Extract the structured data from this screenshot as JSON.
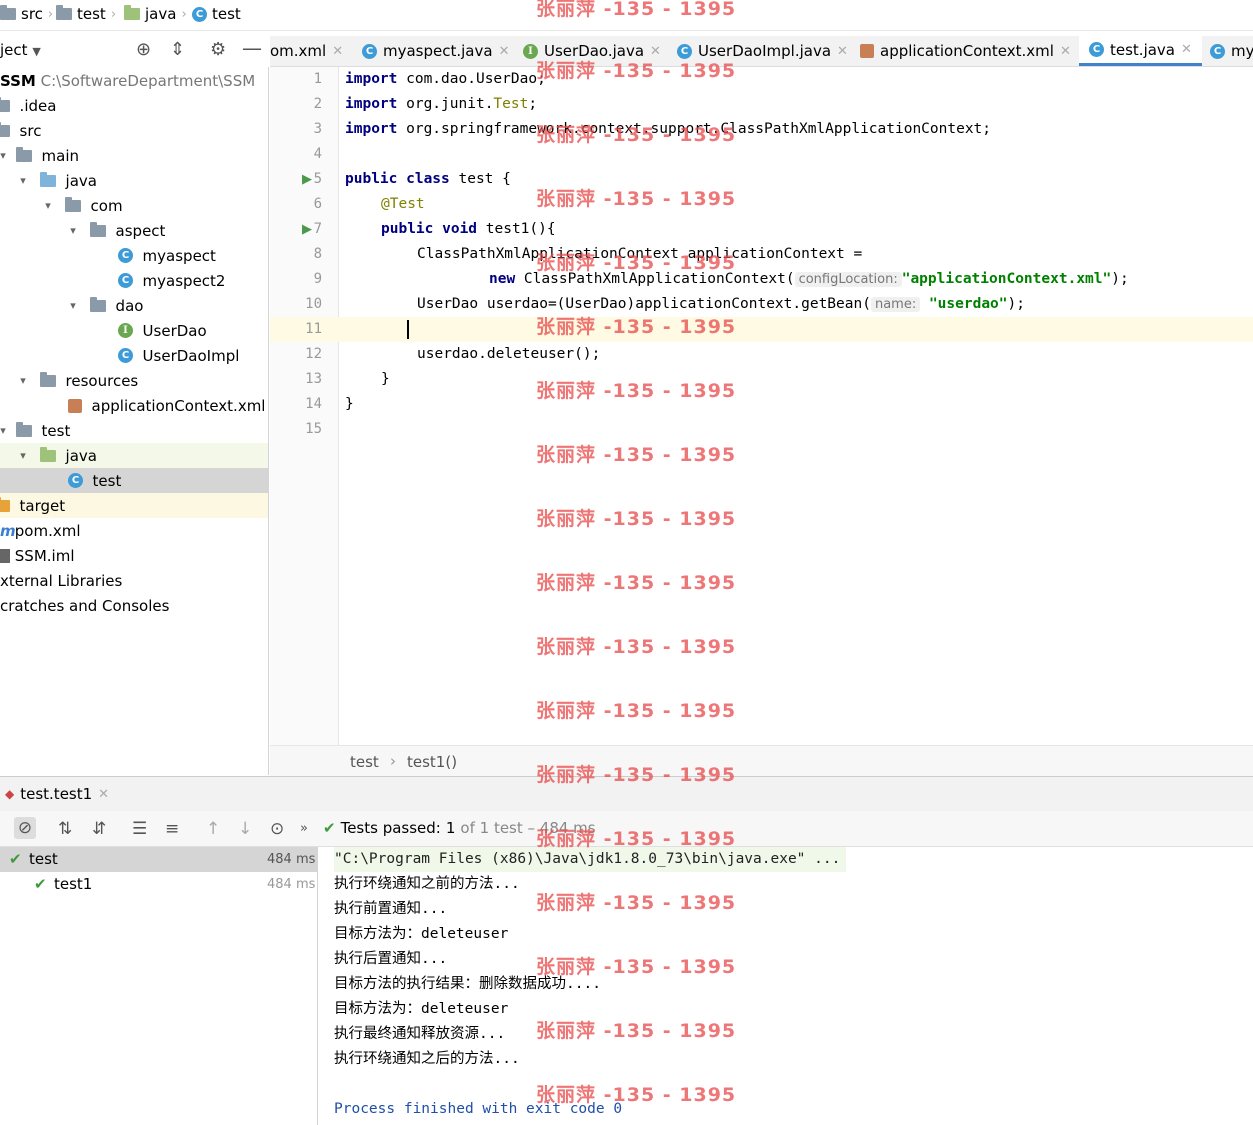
{
  "breadcrumb": [
    "src",
    "test",
    "java",
    "test"
  ],
  "project_toolbar": {
    "label": "ject"
  },
  "tabs": [
    {
      "label": "om.xml"
    },
    {
      "label": "myaspect.java"
    },
    {
      "label": "UserDao.java"
    },
    {
      "label": "UserDaoImpl.java"
    },
    {
      "label": "applicationContext.xml"
    },
    {
      "label": "test.java"
    },
    {
      "label": "my"
    }
  ],
  "tree": [
    {
      "label": "SSM",
      "path": "C:\\SoftwareDepartment\\SSM"
    },
    {
      "label": ".idea"
    },
    {
      "label": "src"
    },
    {
      "label": "main"
    },
    {
      "label": "java"
    },
    {
      "label": "com"
    },
    {
      "label": "aspect"
    },
    {
      "label": "myaspect"
    },
    {
      "label": "myaspect2"
    },
    {
      "label": "dao"
    },
    {
      "label": "UserDao"
    },
    {
      "label": "UserDaoImpl"
    },
    {
      "label": "resources"
    },
    {
      "label": "applicationContext.xml"
    },
    {
      "label": "test"
    },
    {
      "label": "java"
    },
    {
      "label": "test"
    },
    {
      "label": "target"
    },
    {
      "label": "pom.xml"
    },
    {
      "label": "SSM.iml"
    },
    {
      "label": "xternal Libraries"
    },
    {
      "label": "cratches and Consoles"
    }
  ],
  "editor": {
    "line_numbers": [
      "1",
      "2",
      "3",
      "4",
      "5",
      "6",
      "7",
      "8",
      "9",
      "10",
      "11",
      "12",
      "13",
      "14",
      "15"
    ],
    "lines": {
      "l1_kw": "import",
      "l1_rest": " com.dao.UserDao;",
      "l2_kw": "import",
      "l2_rest": " org.junit.",
      "l2_ann": "Test",
      "l2_end": ";",
      "l3_kw": "import",
      "l3_rest": " org.springframework.context.support.ClassPathXmlApplicationContext;",
      "l5_kw": "public class",
      "l5_rest": " test {",
      "l6_ann": "@Test",
      "l7_kw": "public void",
      "l7_rest": " test1(){",
      "l8": "ClassPathXmlApplicationContext applicationContext =",
      "l9_kw": "new",
      "l9_rest": " ClassPathXmlApplicationContext(",
      "l9_hint": "configLocation:",
      "l9_str": "\"applicationContext.xml\"",
      "l9_end": ");",
      "l10_rest": "UserDao userdao=(UserDao)applicationContext.getBean(",
      "l10_hint": "name:",
      "l10_str": "\"userdao\"",
      "l10_end": ");",
      "l12": "userdao.deleteuser();",
      "l13": "}",
      "l14": "}"
    },
    "breadcrumb": [
      "test",
      "test1()"
    ]
  },
  "run": {
    "tab_label": "test.test1",
    "status_prefix": "Tests passed:",
    "status_count": "1",
    "status_suffix": "of 1 test – 484 ms",
    "tree": [
      {
        "label": "test",
        "time": "484 ms"
      },
      {
        "label": "test1",
        "time": "484 ms"
      }
    ],
    "console": [
      "\"C:\\Program Files (x86)\\Java\\jdk1.8.0_73\\bin\\java.exe\" ...",
      "执行环绕通知之前的方法...",
      "执行前置通知...",
      "目标方法为：deleteuser",
      "执行后置通知...",
      "目标方法的执行结果：删除数据成功....",
      "目标方法为：deleteuser",
      "执行最终通知释放资源...",
      "执行环绕通知之后的方法...",
      "",
      "Process finished with exit code 0"
    ]
  },
  "watermark": "张丽萍 -135 - 1395"
}
